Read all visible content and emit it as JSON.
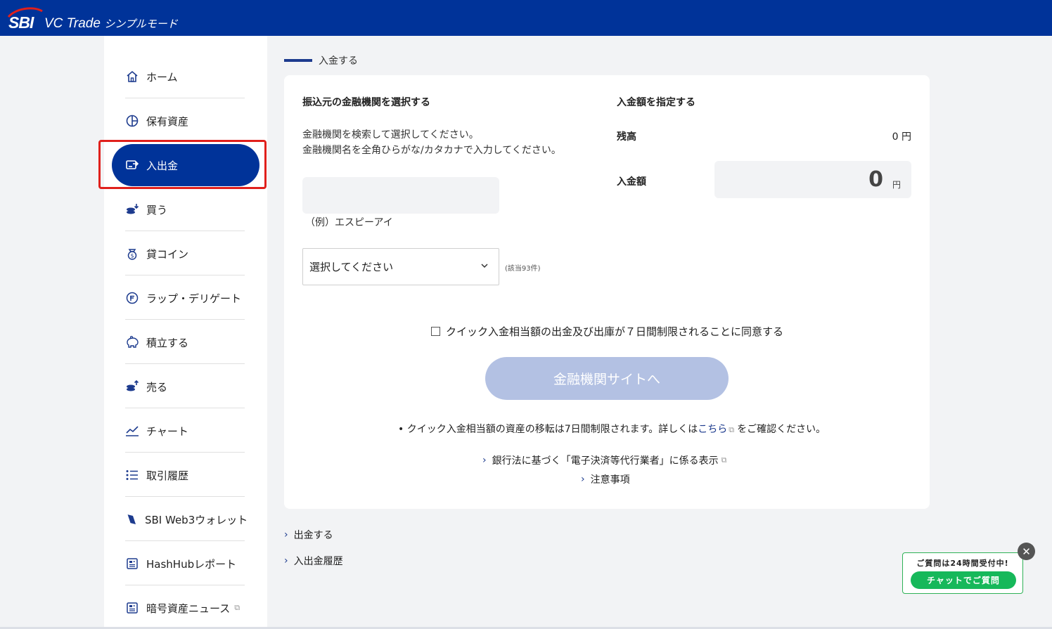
{
  "header": {
    "logo_text": "SBI",
    "app_title": "VC Trade",
    "app_mode": "シンプルモード"
  },
  "sidebar": {
    "items": [
      {
        "label": "ホーム",
        "icon": "home-icon"
      },
      {
        "label": "保有資産",
        "icon": "pie-chart-icon"
      },
      {
        "label": "入出金",
        "icon": "transfer-icon"
      },
      {
        "label": "買う",
        "icon": "buy-coins-icon"
      },
      {
        "label": "貸コイン",
        "icon": "lend-coin-icon"
      },
      {
        "label": "ラップ・デリゲート",
        "icon": "wrap-delegate-icon"
      },
      {
        "label": "積立する",
        "icon": "piggy-bank-icon"
      },
      {
        "label": "売る",
        "icon": "sell-coins-icon"
      },
      {
        "label": "チャート",
        "icon": "chart-icon"
      },
      {
        "label": "取引履歴",
        "icon": "list-icon"
      },
      {
        "label": "SBI Web3ウォレット",
        "icon": "wallet-icon"
      },
      {
        "label": "HashHubレポート",
        "icon": "report-icon"
      },
      {
        "label": "暗号資産ニュース",
        "icon": "news-icon"
      }
    ],
    "active_index": 2
  },
  "page": {
    "heading": "入金する"
  },
  "form": {
    "bank_section_title": "振込元の金融機関を選択する",
    "instruction_line1": "金融機関を検索して選択してください。",
    "instruction_line2": "金融機関名を全角ひらがな/カタカナで入力してください。",
    "search_value": "",
    "example": "（例）エスピーアイ",
    "select_value": "選択してください",
    "match_count": "(該当93件)",
    "amount_section_title": "入金額を指定する",
    "balance_label": "残高",
    "balance_value": "0 円",
    "amount_label": "入金額",
    "amount_value": "0",
    "amount_unit": "円",
    "agree_label": "クイック入金相当額の出金及び出庫が７日間制限されることに同意する",
    "submit_label": "金融機関サイトへ",
    "note_prefix": "• クイック入金相当額の資産の移転は7日間制限されます。詳しくは",
    "note_link": "こちら",
    "note_suffix": "をご確認ください。",
    "link_banking": "銀行法に基づく「電子決済等代行業者」に係る表示",
    "link_notes": "注意事項"
  },
  "bottom_links": {
    "withdraw": "出金する",
    "history": "入出金履歴"
  },
  "chat": {
    "title": "ご質問は24時間受付中!",
    "button": "チャットでご質問"
  },
  "colors": {
    "brand": "#003399",
    "highlight": "#e0201c",
    "chat_green": "#16b85a",
    "disabled_button": "#b3c1e3"
  }
}
